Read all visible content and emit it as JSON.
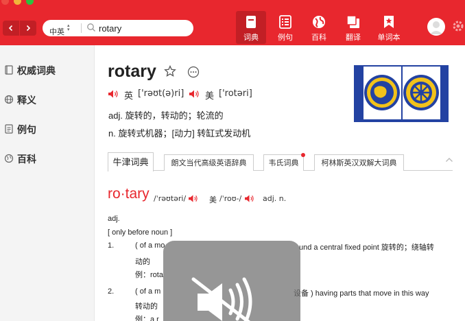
{
  "header": {
    "lang_selector": "中英",
    "search_value": "rotary",
    "tabs": [
      {
        "label": "词典",
        "icon": "dictionary-icon",
        "active": true
      },
      {
        "label": "例句",
        "icon": "list-icon",
        "active": false
      },
      {
        "label": "百科",
        "icon": "globe-icon",
        "active": false
      },
      {
        "label": "翻译",
        "icon": "translate-icon",
        "active": false
      },
      {
        "label": "单词本",
        "icon": "wordbook-icon",
        "active": false
      }
    ]
  },
  "sidebar": {
    "items": [
      {
        "label": "权威词典",
        "icon": "book-icon"
      },
      {
        "label": "释义",
        "icon": "globe-icon"
      },
      {
        "label": "例句",
        "icon": "document-icon"
      },
      {
        "label": "百科",
        "icon": "encyclopedia-icon"
      }
    ]
  },
  "entry": {
    "word": "rotary",
    "uk_label": "英",
    "uk_pron": "['rəʊt(ə)ri]",
    "us_label": "美",
    "us_pron": "['rotəri]",
    "def1": "adj. 旋转的，转动的；轮流的",
    "def2": "n. 旋转式机器；[动力] 转缸式发动机"
  },
  "dict_tabs": [
    {
      "label": "牛津词典",
      "active": true
    },
    {
      "label": "朗文当代高级英语辞典",
      "active": false
    },
    {
      "label": "韦氏词典",
      "active": false,
      "badge": true
    },
    {
      "label": "柯林斯英汉双解大词典",
      "active": false
    }
  ],
  "oxford": {
    "headword": "ro·tary",
    "uk_pron": "/ˈrəʊtəri/",
    "us_label": "美",
    "us_pron": "/ˈroʊ-/",
    "pos": "adj. n.",
    "pos_line": "adj.",
    "grammar": "[ only before noun ]",
    "sense1_num": "1.",
    "sense1_a": "( of a mo",
    "sense1_b": "und a central fixed point 旋转的；绕轴转",
    "sense1_c": "动的",
    "sense1_ex": "例：rota",
    "sense2_num": "2.",
    "sense2_a": "( of a m",
    "sense2_b": "设备 ) having parts that move in this way",
    "sense2_c": "转动的",
    "sense2_ex": "例：a r"
  },
  "colors": {
    "brand_red": "#e8272e",
    "logo_blue": "#2342a2",
    "logo_gold": "#f2c21a"
  }
}
